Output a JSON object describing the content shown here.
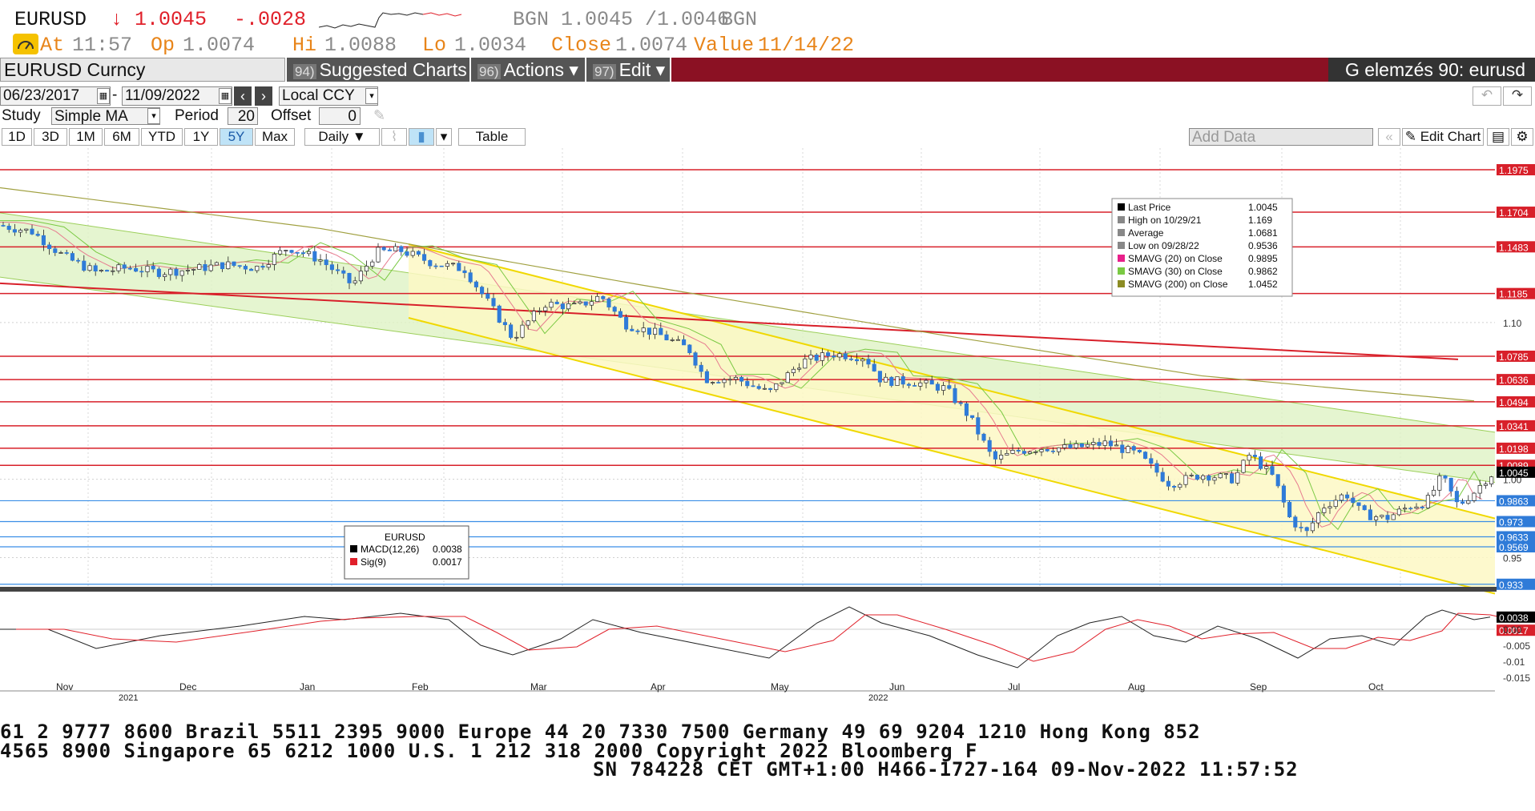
{
  "quote": {
    "ticker": "EURUSD",
    "last": "↓ 1.0045",
    "change": "-.0028",
    "source_left": "BGN",
    "bid_ask": "1.0045 /1.0046",
    "source_right": "BGN",
    "at_label": "At",
    "at_time": "11:57",
    "op_label": "Op",
    "op": "1.0074",
    "hi_label": "Hi",
    "hi": "1.0088",
    "lo_label": "Lo",
    "lo": "1.0034",
    "close_label": "Close",
    "close": "1.0074",
    "value_label": "Value",
    "value_date": "11/14/22"
  },
  "titlebar": {
    "security": "EURUSD Curncy",
    "suggested_num": "94)",
    "suggested": "Suggested Charts",
    "actions_num": "96)",
    "actions": "Actions ▾",
    "edit_num": "97)",
    "edit": "Edit ▾",
    "analysis": "G elemzés 90: eurusd"
  },
  "controls": {
    "start_date": "06/23/2017",
    "end_date": "11/09/2022",
    "currency": "Local CCY",
    "study_label": "Study",
    "study": "Simple MA",
    "period_label": "Period",
    "period": "20",
    "offset_label": "Offset",
    "offset": "0",
    "ranges": [
      "1D",
      "3D",
      "1M",
      "6M",
      "YTD",
      "1Y",
      "5Y",
      "Max"
    ],
    "active_range": "5Y",
    "frequency": "Daily ▼",
    "table": "Table",
    "add_data_placeholder": "Add Data",
    "edit_chart": "Edit Chart"
  },
  "legend": {
    "rows": [
      {
        "label": "Last Price",
        "value": "1.0045",
        "color": "#000000"
      },
      {
        "label": "High on 10/29/21",
        "value": "1.169",
        "color": "#888888"
      },
      {
        "label": "Average",
        "value": "1.0681",
        "color": "#888888"
      },
      {
        "label": "Low on 09/28/22",
        "value": "0.9536",
        "color": "#888888"
      },
      {
        "label": "SMAVG (20)  on Close",
        "value": "0.9895",
        "color": "#e8208a"
      },
      {
        "label": "SMAVG (30)  on Close",
        "value": "0.9862",
        "color": "#7ac943"
      },
      {
        "label": "SMAVG (200)  on Close",
        "value": "1.0452",
        "color": "#8c8c24"
      }
    ]
  },
  "macd_legend": {
    "title": "EURUSD",
    "rows": [
      {
        "label": "MACD(12,26)",
        "value": "0.0038",
        "color": "#000000"
      },
      {
        "label": "Sig(9)",
        "value": "0.0017",
        "color": "#e0202a"
      }
    ]
  },
  "price_axis": {
    "red_tags": [
      "1.1975",
      "1.1704",
      "1.1483",
      "1.1185",
      "1.0785",
      "1.0636",
      "1.0494",
      "1.0341",
      "1.0198",
      "1.0089"
    ],
    "blue_tags": [
      "0.9863",
      "0.973",
      "0.9633",
      "0.9569",
      "0.933"
    ],
    "gray_ticks": [
      "1.10",
      "1.00",
      "0.95"
    ],
    "last_tag": "1.0045",
    "macd_tags": [
      "0.0038",
      "0.0017"
    ],
    "macd_ticks": [
      "0.00",
      "-0.005",
      "-0.01",
      "-0.015"
    ]
  },
  "time_axis": {
    "months": [
      "Nov",
      "Dec",
      "Jan",
      "Feb",
      "Mar",
      "Apr",
      "May",
      "Jun",
      "Jul",
      "Aug",
      "Sep",
      "Oct"
    ],
    "years": [
      "2021",
      "2022"
    ]
  },
  "footer": {
    "line1": "61 2 9777 8600 Brazil 5511 2395 9000 Europe 44 20 7330 7500 Germany 49 69 9204 1210 Hong Kong 852",
    "line2": " 4565 8900       Singapore 65 6212 1000       U.S. 1 212 318 2000          Copyright 2022 Bloomberg F",
    "line3": "SN 784228 CET  GMT+1:00 H466-1727-164 09-Nov-2022 11:57:52"
  },
  "colors": {
    "maroon": "#8b1123",
    "red_line": "#e0202a",
    "blue_line": "#3a8ee6",
    "green_channel": "#d9f0b8",
    "yellow_channel": "#fdf9c8"
  }
}
